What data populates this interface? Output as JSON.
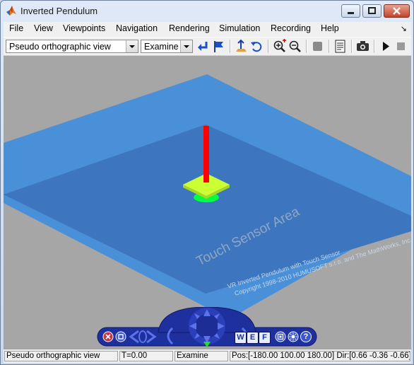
{
  "window": {
    "title": "Inverted Pendulum"
  },
  "menu": {
    "items": [
      "File",
      "View",
      "Viewpoints",
      "Navigation",
      "Rendering",
      "Simulation",
      "Recording",
      "Help"
    ]
  },
  "toolbar": {
    "viewpoint_select": {
      "selected": "Pseudo orthographic view"
    },
    "navigation_select": {
      "selected": "Examine"
    }
  },
  "scene": {
    "sensor_label": "Touch Sensor Area",
    "caption_line1": "VR Inverted Pendulum with Touch Sensor",
    "caption_line2": "Copyright 1998-2010 HUMUSOFT s.r.o. and The MathWorks, Inc.",
    "colors": {
      "floor": "#4a90d8",
      "inner_floor": "#3d76bf",
      "pendulum": "#ff0000",
      "cart": "#ccff33",
      "base": "#00ff40"
    }
  },
  "navpanel": {
    "buttons": [
      "W",
      "E",
      "F"
    ],
    "help": "?"
  },
  "status": {
    "viewpoint": "Pseudo orthographic view",
    "time": "T=0.00",
    "mode": "Examine",
    "position": "Pos:[-180.00 100.00 180.00] Dir:[0.66 -0.36 -0.66]"
  }
}
